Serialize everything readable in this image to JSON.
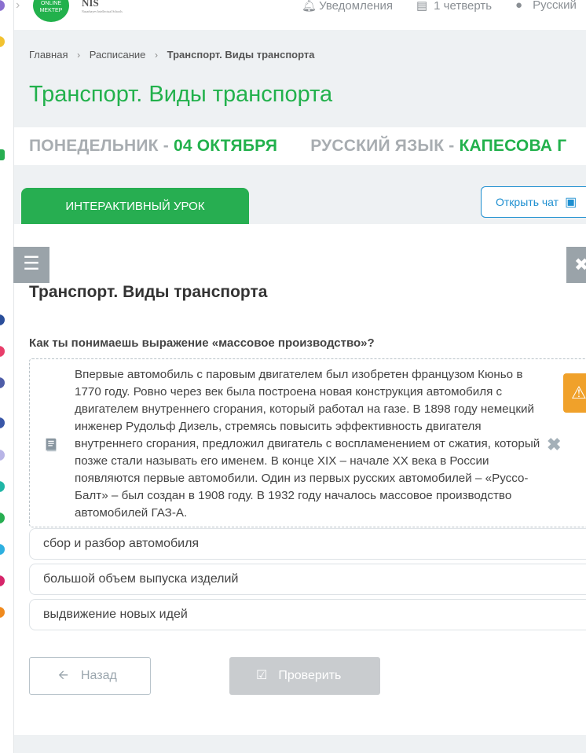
{
  "topbar": {
    "logo_text": "ONLINE MEKTEP",
    "nis_text": "NIS",
    "nis_sub": "Nazarbayev Intellectual Schools",
    "notifications_label": "Уведомления",
    "quarter_label": "1 четверть",
    "language_label": "Русский"
  },
  "breadcrumbs": {
    "home": "Главная",
    "schedule": "Расписание",
    "current": "Транспорт. Виды транспорта"
  },
  "page_title": "Транспорт. Виды транспорта",
  "datebar": {
    "day": "ПОНЕДЕЛЬНИК - ",
    "date": "04 ОКТЯБРЯ",
    "subject": "РУССКИЙ ЯЗЫК - ",
    "teacher": "КАПЕСОВА Г"
  },
  "tabs": {
    "interactive_label": "ИНТЕРАКТИВНЫЙ УРОК",
    "chat_label": "Открыть чат"
  },
  "lesson": {
    "title": "Транспорт. Виды транспорта",
    "question": "Как ты понимаешь выражение «массовое производство»?",
    "passage": "Впервые автомобиль с паровым двигателем был изобретен французом Кюньо в 1770 году. Ровно через век была построена новая конструкция автомобиля с двигателем внутреннего сгорания, который работал на газе. В 1898 году немецкий инженер Рудольф Дизель, стремясь повысить эффективность двигателя внутреннего сгорания, предложил двигатель с воспламенением от сжатия, который позже стали называть его именем. В конце XIX – начале XX века в России появляются первые автомобили. Один из первых русских автомобилей – «Руссо-Балт» – был создан в 1908 году. В 1932 году началось массовое производство автомобилей ГАЗ-А.",
    "options": [
      "сбор и разбор автомобиля",
      "большой объем выпуска изделий",
      "выдвижение новых идей"
    ]
  },
  "actions": {
    "back_label": "Назад",
    "check_label": "Проверить"
  },
  "colors": {
    "brand_green": "#22b14c",
    "accent_blue": "#1e8fd0",
    "warning_orange": "#f0a12a",
    "disabled_gray": "#c9cccf"
  }
}
